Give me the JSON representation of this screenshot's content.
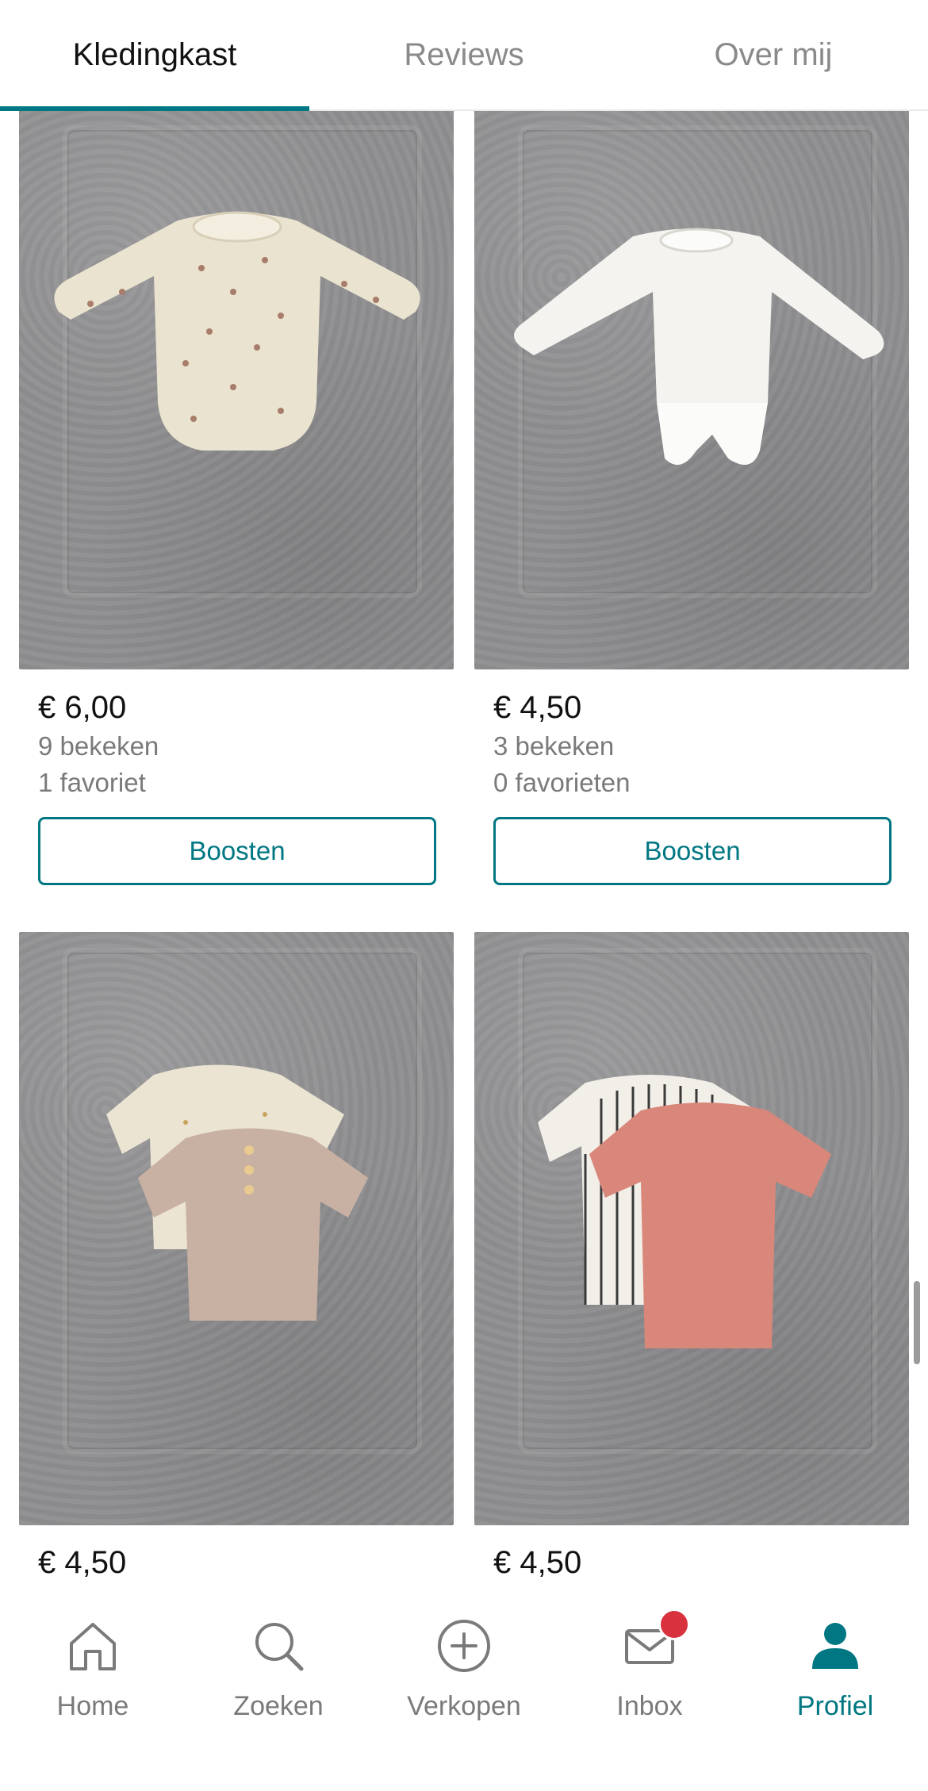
{
  "tabs": [
    {
      "label": "Kledingkast"
    },
    {
      "label": "Reviews"
    },
    {
      "label": "Over mij"
    }
  ],
  "items": [
    {
      "price": "€ 6,00",
      "views": "9 bekeken",
      "favorites": "1 favoriet",
      "boost_label": "Boosten",
      "image_icon": "floral-bodysuit-photo"
    },
    {
      "price": "€ 4,50",
      "views": "3 bekeken",
      "favorites": "0 favorieten",
      "boost_label": "Boosten",
      "image_icon": "white-bodysuit-photo"
    },
    {
      "price": "€ 4,50",
      "image_icon": "two-tshirts-beige-photo"
    },
    {
      "price": "€ 4,50",
      "image_icon": "striped-pink-tshirts-photo"
    }
  ],
  "bottom_nav": [
    {
      "label": "Home",
      "icon": "home-icon"
    },
    {
      "label": "Zoeken",
      "icon": "search-icon"
    },
    {
      "label": "Verkopen",
      "icon": "plus-circle-icon"
    },
    {
      "label": "Inbox",
      "icon": "mail-icon"
    },
    {
      "label": "Profiel",
      "icon": "profile-icon"
    }
  ],
  "colors": {
    "accent": "#007782",
    "badge": "#d8323f"
  }
}
